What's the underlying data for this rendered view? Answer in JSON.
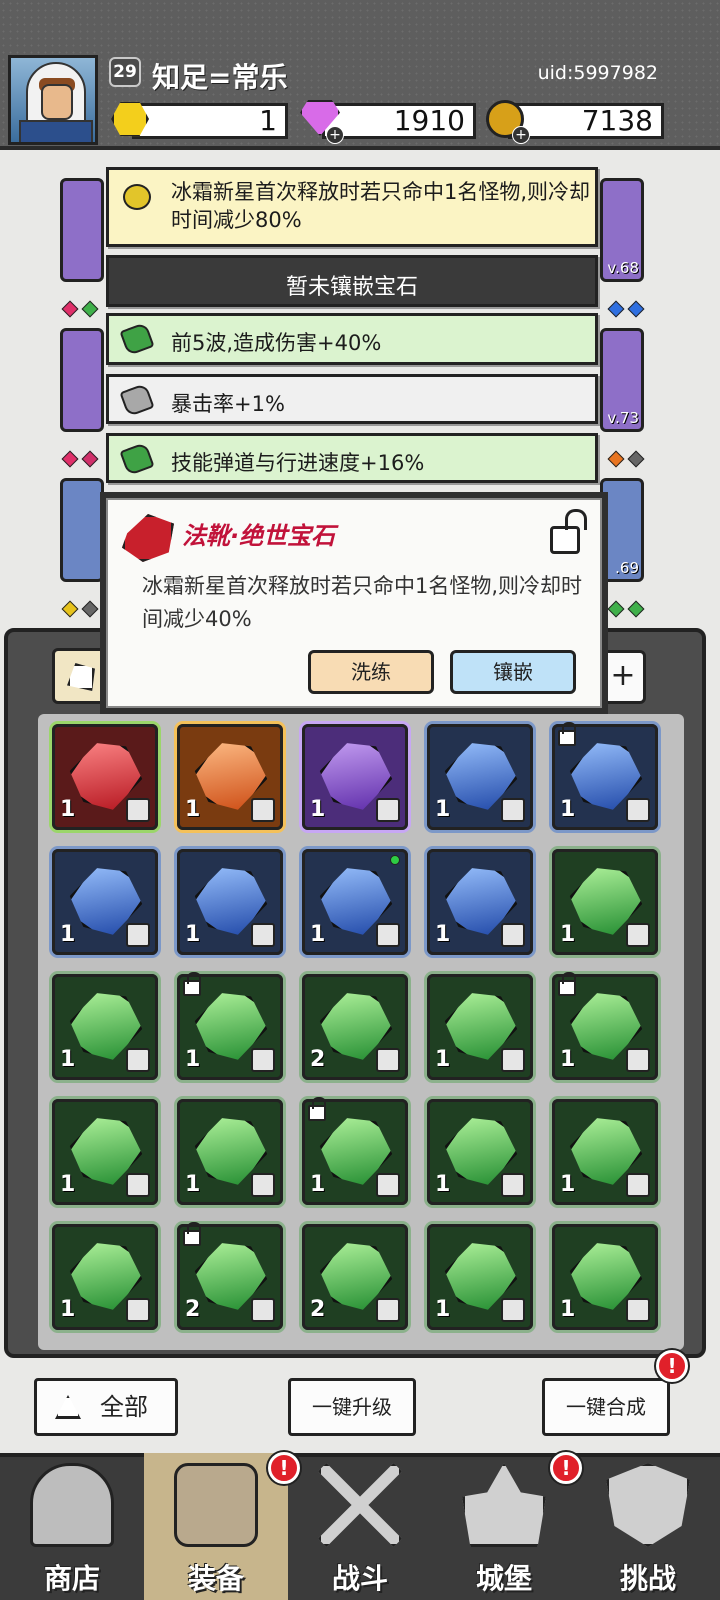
{
  "player": {
    "level": "29",
    "name": "知足=常乐",
    "uid": "uid:5997982"
  },
  "currencies": [
    {
      "icon": "yellow-hexagon-icon",
      "value": "1",
      "has_plus": false
    },
    {
      "icon": "pink-diamond-icon",
      "value": "1910",
      "has_plus": true
    },
    {
      "icon": "gold-coin-icon",
      "value": "7138",
      "has_plus": true
    }
  ],
  "equipment_levels": [
    "v.68",
    "v.73",
    ".69"
  ],
  "tooltip": {
    "description": "冰霜新星首次释放时若只命中1名怪物,则冷却时间减少80%",
    "empty_socket": "暂未镶嵌宝石",
    "stats": [
      {
        "text": "前5波,造成伤害+40%",
        "gem": "green"
      },
      {
        "text": "暴击率+1%",
        "gem": "gray"
      },
      {
        "text": "技能弹道与行进速度+16%",
        "gem": "green"
      }
    ]
  },
  "gem_dialog": {
    "title": "法靴·绝世宝石",
    "description": "冰霜新星首次释放时若只命中1名怪物,则冷却时间减少40%",
    "refine_label": "洗练",
    "inlay_label": "镶嵌",
    "icon": "red-gem-icon",
    "lock_icon": "unlock-icon"
  },
  "grid_header": {
    "add_label": "+"
  },
  "gems": [
    {
      "color": "red",
      "count": "1",
      "slot": "boot",
      "locked": false,
      "new": false
    },
    {
      "color": "orange",
      "count": "1",
      "slot": "ring",
      "locked": false,
      "new": false
    },
    {
      "color": "purple",
      "count": "1",
      "slot": "ring",
      "locked": false,
      "new": false
    },
    {
      "color": "blue",
      "count": "1",
      "slot": "armor",
      "locked": false,
      "new": false
    },
    {
      "color": "blue",
      "count": "1",
      "slot": "weapon",
      "locked": true,
      "new": false
    },
    {
      "color": "blue",
      "count": "1",
      "slot": "weapon",
      "locked": false,
      "new": false
    },
    {
      "color": "blue",
      "count": "1",
      "slot": "helmet",
      "locked": false,
      "new": false
    },
    {
      "color": "blue",
      "count": "1",
      "slot": "helmet",
      "locked": false,
      "new": true
    },
    {
      "color": "blue",
      "count": "1",
      "slot": "necklace",
      "locked": false,
      "new": false
    },
    {
      "color": "green",
      "count": "1",
      "slot": "ring",
      "locked": false,
      "new": false
    },
    {
      "color": "green",
      "count": "1",
      "slot": "ring",
      "locked": false,
      "new": false
    },
    {
      "color": "green",
      "count": "1",
      "slot": "armor",
      "locked": true,
      "new": false
    },
    {
      "color": "green",
      "count": "2",
      "slot": "armor",
      "locked": false,
      "new": false
    },
    {
      "color": "green",
      "count": "1",
      "slot": "armor",
      "locked": false,
      "new": false
    },
    {
      "color": "green",
      "count": "1",
      "slot": "boot",
      "locked": true,
      "new": false
    },
    {
      "color": "green",
      "count": "1",
      "slot": "boot",
      "locked": false,
      "new": false
    },
    {
      "color": "green",
      "count": "1",
      "slot": "boot",
      "locked": false,
      "new": false
    },
    {
      "color": "green",
      "count": "1",
      "slot": "weapon",
      "locked": true,
      "new": false
    },
    {
      "color": "green",
      "count": "1",
      "slot": "weapon",
      "locked": false,
      "new": false
    },
    {
      "color": "green",
      "count": "1",
      "slot": "weapon",
      "locked": false,
      "new": false
    },
    {
      "color": "green",
      "count": "1",
      "slot": "helmet",
      "locked": false,
      "new": false
    },
    {
      "color": "green",
      "count": "2",
      "slot": "helmet",
      "locked": true,
      "new": false
    },
    {
      "color": "green",
      "count": "2",
      "slot": "necklace",
      "locked": false,
      "new": false
    },
    {
      "color": "green",
      "count": "1",
      "slot": "necklace",
      "locked": false,
      "new": false
    },
    {
      "color": "green",
      "count": "1",
      "slot": "necklace",
      "locked": false,
      "new": false
    }
  ],
  "actions": {
    "all_label": "全部",
    "upgrade_label": "一键升级",
    "merge_label": "一键合成",
    "alert": "!"
  },
  "nav": [
    {
      "label": "商店",
      "icon": "shop-hut-icon",
      "active": false,
      "alert": false
    },
    {
      "label": "装备",
      "icon": "backpack-icon",
      "active": true,
      "alert": true
    },
    {
      "label": "战斗",
      "icon": "crossed-swords-icon",
      "active": false,
      "alert": false
    },
    {
      "label": "城堡",
      "icon": "castle-icon",
      "active": false,
      "alert": true
    },
    {
      "label": "挑战",
      "icon": "shield-icon",
      "active": false,
      "alert": false
    }
  ]
}
